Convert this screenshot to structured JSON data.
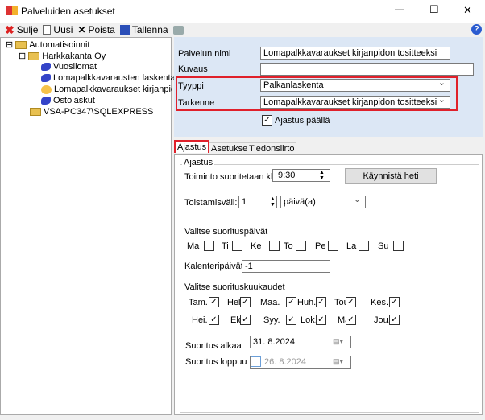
{
  "window": {
    "title": "Palveluiden asetukset",
    "minimize": "—",
    "maximize": "☐",
    "close": "✕"
  },
  "toolbar": {
    "close": "Sulje",
    "new": "Uusi",
    "delete": "Poista",
    "save": "Tallenna",
    "help": "?"
  },
  "tree": {
    "root": "Automatisoinnit",
    "company": "Harkkakanta Oy",
    "items": [
      "Vuosilomat",
      "Lomapalkkavarausten laskenta",
      "Lomapalkkavaraukset kirjanpidon tositteeksi",
      "Ostolaskut"
    ],
    "server": "VSA-PC347\\SQLEXPRESS"
  },
  "form": {
    "name_label": "Palvelun nimi",
    "name_value": "Lomapalkkavaraukset kirjanpidon tositteeksi",
    "desc_label": "Kuvaus",
    "desc_value": "",
    "type_label": "Tyyppi",
    "type_value": "Palkanlaskenta",
    "spec_label": "Tarkenne",
    "spec_value": "Lomapalkkavaraukset kirjanpidon tositteeksi",
    "enabled_label": "Ajastus päällä",
    "enabled": true,
    "highlight_color": "#e0202a"
  },
  "tabs": [
    "Ajastus",
    "Asetukset",
    "Tiedonsiirto"
  ],
  "schedule": {
    "group": "Ajastus",
    "time_label": "Toiminto suoritetaan klo",
    "time": "9:30",
    "run_now": "Käynnistä heti",
    "interval_label": "Toistamisväli:",
    "interval": "1",
    "interval_unit": "päivä(a)",
    "days_label": "Valitse suorituspäivät",
    "days": [
      "Ma",
      "Ti",
      "Ke",
      "To",
      "Pe",
      "La",
      "Su"
    ],
    "calendar_label": "Kalenteripäivät",
    "calendar_value": "-1",
    "months_label": "Valitse suorituskuukaudet",
    "months1": [
      "Tam.",
      "Hel.",
      "Maa.",
      "Huh.",
      "Tou.",
      "Kes."
    ],
    "months2": [
      "Hei.",
      "Elo.",
      "Syy.",
      "Lok.",
      "Mar.",
      "Jou."
    ],
    "start_label": "Suoritus alkaa",
    "start": "31.  8.2024",
    "end_label": "Suoritus loppuu",
    "end": "26.  8.2024"
  }
}
